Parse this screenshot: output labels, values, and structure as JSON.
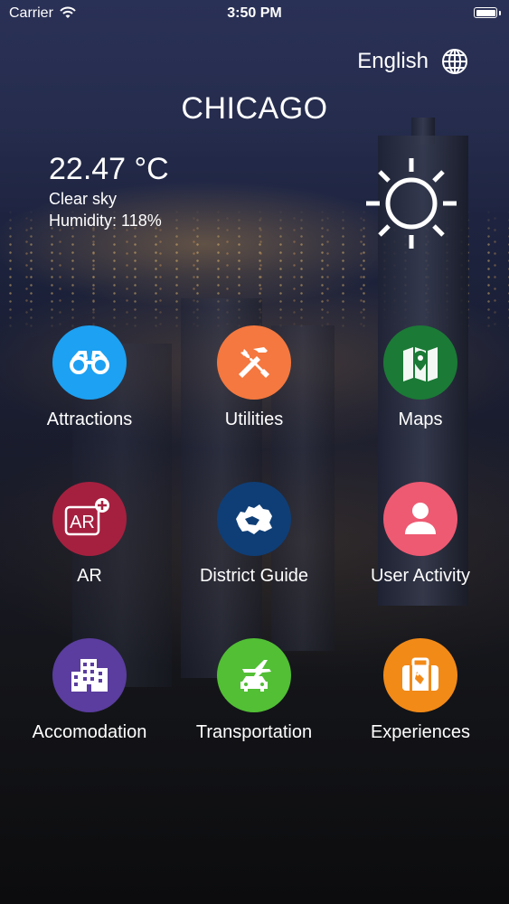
{
  "status_bar": {
    "carrier": "Carrier",
    "time": "3:50 PM",
    "icons": [
      "wifi-icon",
      "battery-icon"
    ]
  },
  "header": {
    "language": "English",
    "language_icon": "globe-icon"
  },
  "city": "CHICAGO",
  "weather": {
    "temperature": "22.47 °C",
    "condition": "Clear sky",
    "humidity": "Humidity: 118%",
    "icon": "sun-icon"
  },
  "menu": [
    {
      "label": "Attractions",
      "icon": "binoculars-icon",
      "color": "#1da1f2"
    },
    {
      "label": "Utilities",
      "icon": "tools-icon",
      "color": "#f4783f"
    },
    {
      "label": "Maps",
      "icon": "map-pin-icon",
      "color": "#1b7a36"
    },
    {
      "label": "AR",
      "icon": "ar-icon",
      "color": "#a5203f"
    },
    {
      "label": "District Guide",
      "icon": "district-map-icon",
      "color": "#0f3e76"
    },
    {
      "label": "User Activity",
      "icon": "user-icon",
      "color": "#ee5a72"
    },
    {
      "label": "Accomodation",
      "icon": "building-icon",
      "color": "#5a3d9e"
    },
    {
      "label": "Transportation",
      "icon": "plane-car-icon",
      "color": "#52bf35"
    },
    {
      "label": "Experiences",
      "icon": "suitcase-icon",
      "color": "#f28a18"
    }
  ]
}
